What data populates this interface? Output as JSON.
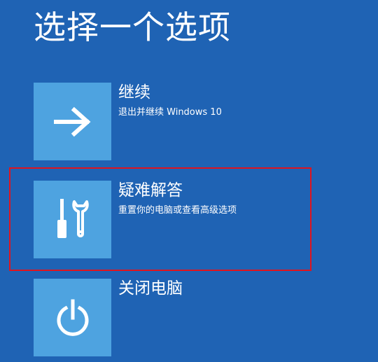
{
  "page": {
    "title": "选择一个选项"
  },
  "options": [
    {
      "label": "继续",
      "description": "退出并继续 Windows 10",
      "icon": "arrow-right-icon"
    },
    {
      "label": "疑难解答",
      "description": "重置你的电脑或查看高级选项",
      "icon": "tools-icon"
    },
    {
      "label": "关闭电脑",
      "description": "",
      "icon": "power-icon"
    }
  ],
  "colors": {
    "background": "#1f63b4",
    "tile": "#4ea3e0",
    "text": "#ffffff",
    "highlight": "#e0141e"
  }
}
